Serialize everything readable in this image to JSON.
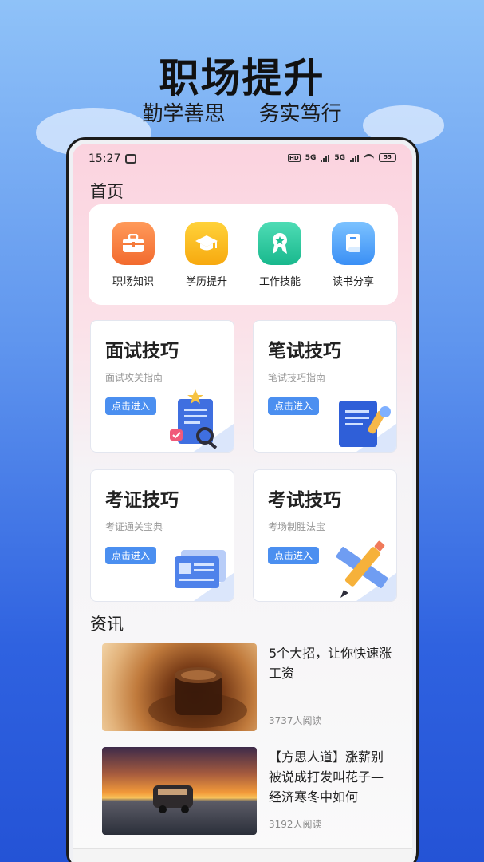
{
  "hero": {
    "title": "职场提升",
    "slogan_left": "勤学善思",
    "slogan_right": "务实笃行"
  },
  "status_bar": {
    "time": "15:27",
    "network_1": "5G",
    "network_2": "5G",
    "battery": "55"
  },
  "page": {
    "title": "首页"
  },
  "categories": [
    {
      "label": "职场知识",
      "icon": "briefcase-icon",
      "color": "#f57a3a"
    },
    {
      "label": "学历提升",
      "icon": "graduation-cap-icon",
      "color": "#f7b514"
    },
    {
      "label": "工作技能",
      "icon": "award-badge-icon",
      "color": "#20c093"
    },
    {
      "label": "读书分享",
      "icon": "book-icon",
      "color": "#4595f6"
    }
  ],
  "cards": [
    {
      "title": "面试技巧",
      "subtitle": "面试攻关指南",
      "button": "点击进入",
      "icon": "document-search-icon"
    },
    {
      "title": "笔试技巧",
      "subtitle": "笔试技巧指南",
      "button": "点击进入",
      "icon": "notepad-pencil-icon"
    },
    {
      "title": "考证技巧",
      "subtitle": "考证通关宝典",
      "button": "点击进入",
      "icon": "certificate-cards-icon"
    },
    {
      "title": "考试技巧",
      "subtitle": "考场制胜法宝",
      "button": "点击进入",
      "icon": "pencil-ruler-icon"
    }
  ],
  "news": {
    "title": "资讯",
    "items": [
      {
        "title": "5个大招，让你快速涨工资",
        "reads": "3737人阅读"
      },
      {
        "title": "【方思人道】涨薪别被说成打发叫花子—经济寒冬中如何",
        "reads": "3192人阅读"
      }
    ]
  },
  "colors": {
    "accent": "#4b8ff0",
    "background_top": "#8fc2f8",
    "background_bottom": "#2453d6"
  }
}
